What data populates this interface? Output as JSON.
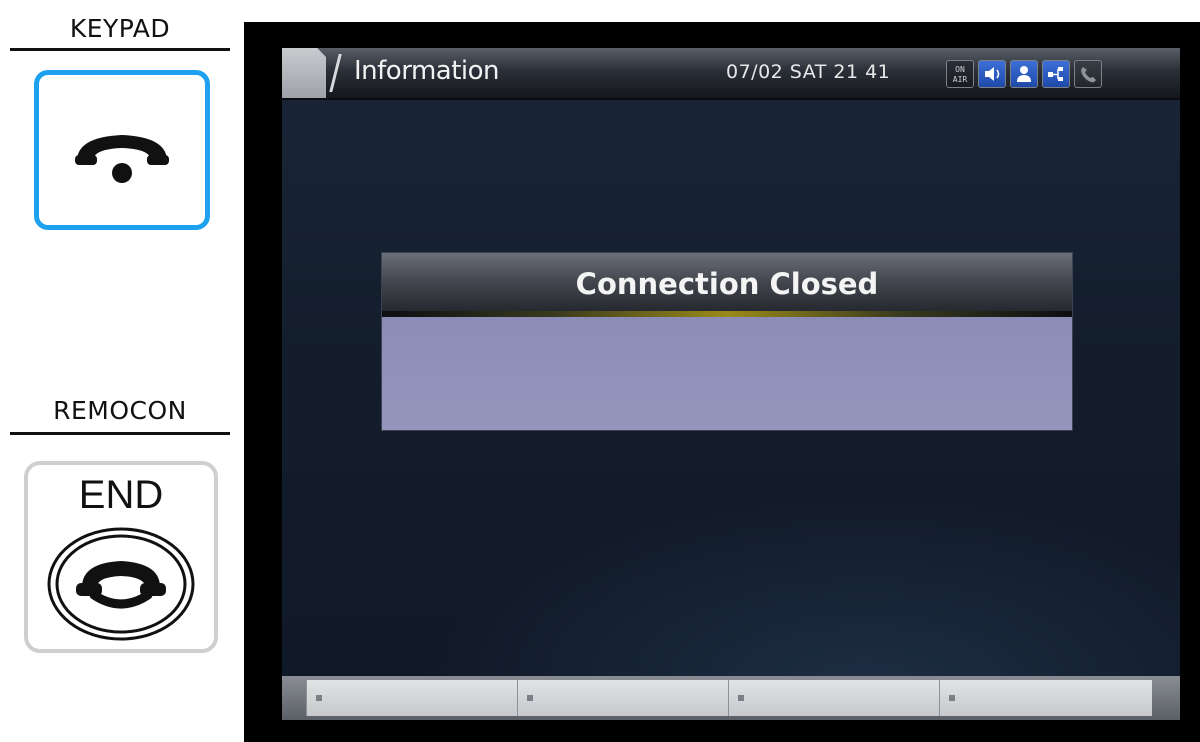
{
  "legend": {
    "keypad": {
      "title": "KEYPAD",
      "key_icon": "hang-up-icon"
    },
    "remocon": {
      "title": "REMOCON",
      "key_label": "END",
      "key_icon": "end-call-icon"
    }
  },
  "screen": {
    "header": {
      "title": "Information",
      "datetime": "07/02 SAT 21 41",
      "status_icons": [
        "on-air-icon",
        "speaker-icon",
        "user-icon",
        "network-icon",
        "handset-icon"
      ],
      "on_air_text": "ON\nAIR"
    },
    "dialog": {
      "title": "Connection Closed",
      "body": ""
    },
    "softkeys": [
      "",
      "",
      "",
      ""
    ]
  },
  "colors": {
    "keypad_border": "#1ea1f0",
    "dialog_body": "#9191ba",
    "dialog_glow": "#9a8a1a",
    "status_icon_blue": "#2d5cc4"
  }
}
